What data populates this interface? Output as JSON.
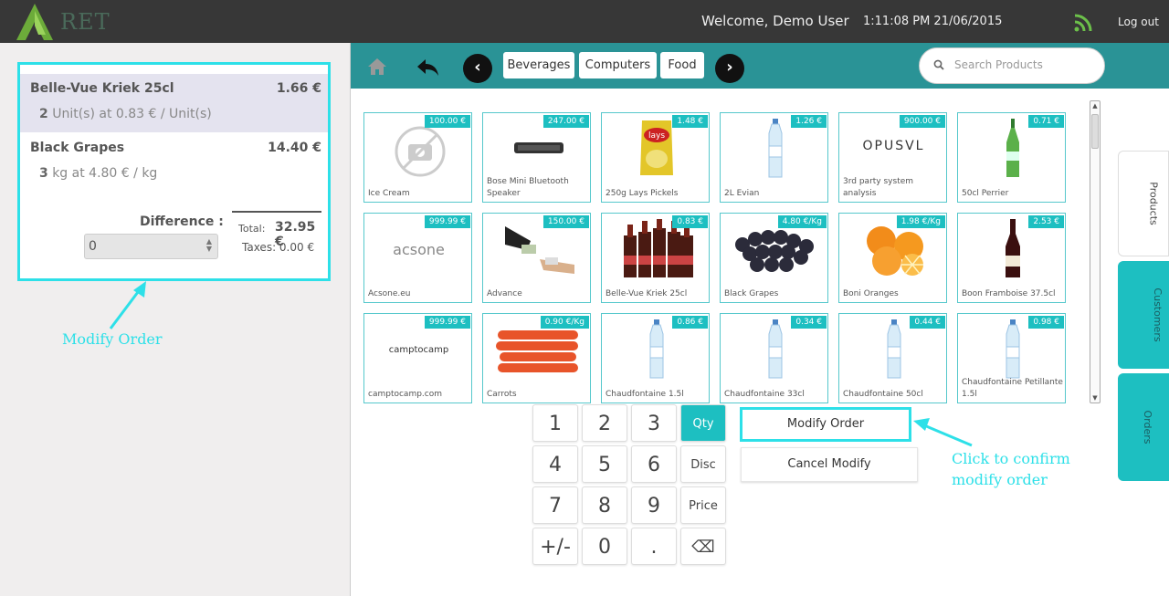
{
  "header": {
    "logo_text": "RET",
    "welcome": "Welcome, Demo User",
    "clock": "1:11:08 PM 21/06/2015",
    "logout": "Log out"
  },
  "order": {
    "lines": [
      {
        "name": "Belle-Vue Kriek 25cl",
        "price": "1.66 €",
        "qty": "2",
        "detail": "Unit(s) at 0.83 € / Unit(s)"
      },
      {
        "name": "Black Grapes",
        "price": "14.40 €",
        "qty": "3",
        "detail": "kg at 4.80 € / kg"
      }
    ],
    "difference_label": "Difference :",
    "difference_value": "0",
    "total_label": "Total:",
    "total_value": "32.95 €",
    "taxes": "Taxes: 0.00 €"
  },
  "annotations": {
    "left": "Modify Order",
    "right_line1": "Click to confirm",
    "right_line2": "modify order"
  },
  "categories": [
    "Beverages",
    "Computers",
    "Food"
  ],
  "search": {
    "placeholder": "Search Products"
  },
  "products": [
    {
      "name": "Ice Cream",
      "price": "100.00 €",
      "icon": "no-photo-icon"
    },
    {
      "name": "Bose Mini Bluetooth Speaker",
      "price": "247.00 €",
      "icon": "speaker-icon"
    },
    {
      "name": "250g Lays Pickels",
      "price": "1.48 €",
      "icon": "chips-bag-icon"
    },
    {
      "name": "2L Evian",
      "price": "1.26 €",
      "icon": "water-bottle-icon"
    },
    {
      "name": "3rd party system analysis",
      "price": "900.00 €",
      "icon": "opusvl-logo",
      "logo": "OPUSVL"
    },
    {
      "name": "50cl Perrier",
      "price": "0.71 €",
      "icon": "green-bottle-icon"
    },
    {
      "name": "Acsone.eu",
      "price": "999.99 €",
      "icon": "acsone-logo",
      "logo": "acsone"
    },
    {
      "name": "Advance",
      "price": "150.00 €",
      "icon": "money-hands-icon"
    },
    {
      "name": "Belle-Vue Kriek 25cl",
      "price": "0.83 €",
      "icon": "beer-bottles-icon"
    },
    {
      "name": "Black Grapes",
      "price": "4.80 €/Kg",
      "icon": "grapes-icon"
    },
    {
      "name": "Boni Oranges",
      "price": "1.98 €/Kg",
      "icon": "oranges-icon"
    },
    {
      "name": "Boon Framboise 37.5cl",
      "price": "2.53 €",
      "icon": "dark-bottle-icon"
    },
    {
      "name": "camptocamp.com",
      "price": "999.99 €",
      "icon": "camptocamp-logo",
      "logo": "camptocamp"
    },
    {
      "name": "Carrots",
      "price": "0.90 €/Kg",
      "icon": "carrots-icon"
    },
    {
      "name": "Chaudfontaine 1.5l",
      "price": "0.86 €",
      "icon": "water-bottle-icon"
    },
    {
      "name": "Chaudfontaine 33cl",
      "price": "0.34 €",
      "icon": "water-bottle-icon"
    },
    {
      "name": "Chaudfontaine 50cl",
      "price": "0.44 €",
      "icon": "water-bottle-icon"
    },
    {
      "name": "Chaudfontaine Petillante 1.5l",
      "price": "0.98 €",
      "icon": "water-bottle-icon"
    }
  ],
  "side_tabs": [
    "Products",
    "Customers",
    "Orders"
  ],
  "numpad": {
    "keys": [
      "1",
      "2",
      "3",
      "Qty",
      "4",
      "5",
      "6",
      "Disc",
      "7",
      "8",
      "9",
      "Price",
      "+/-",
      "0",
      ".",
      "⌫"
    ],
    "active": "Qty"
  },
  "actions": {
    "modify": "Modify Order",
    "cancel": "Cancel Modify"
  },
  "colors": {
    "accent": "#2de0e8",
    "teal": "#2a9396",
    "price_badge": "#1dbfc1",
    "topbar": "#373737"
  }
}
